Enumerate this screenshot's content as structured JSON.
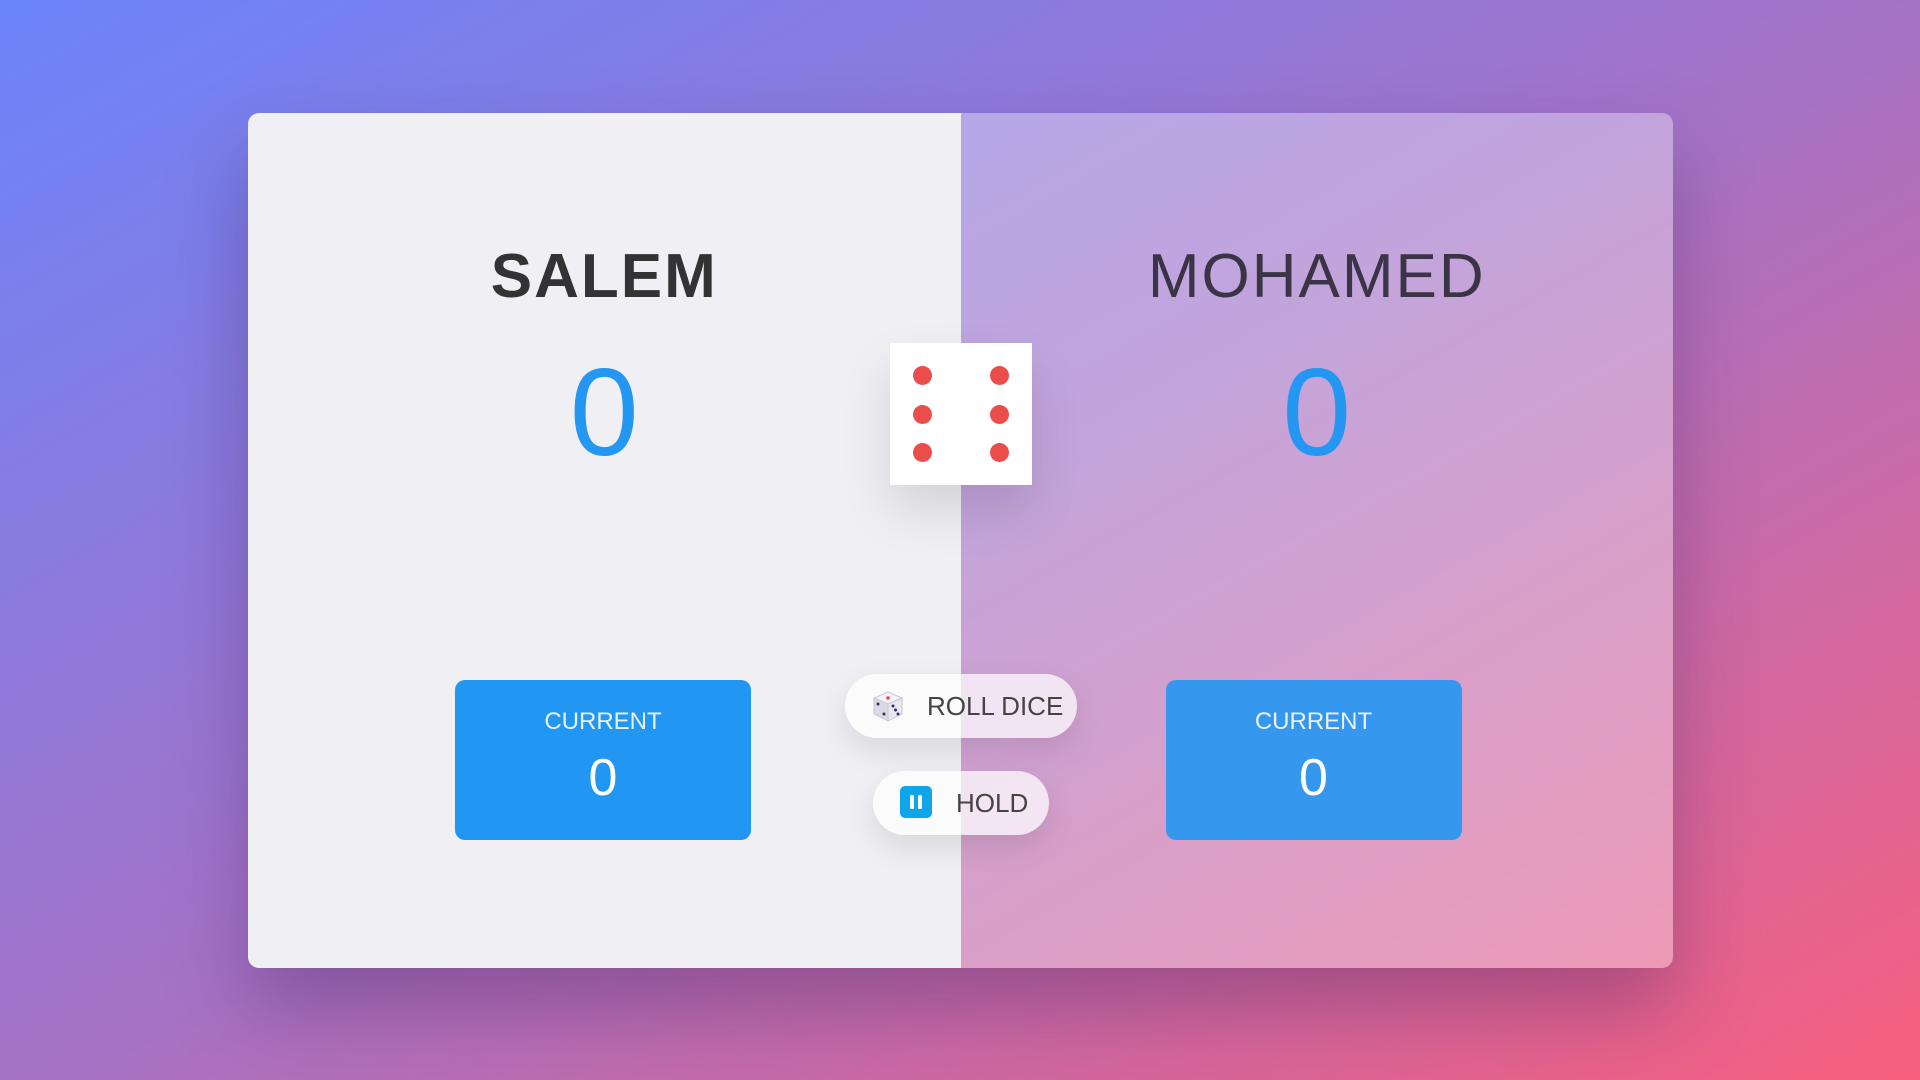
{
  "players": [
    {
      "name": "Salem",
      "score": "0",
      "current_label": "Current",
      "current_score": "0",
      "active": true
    },
    {
      "name": "Mohamed",
      "score": "0",
      "current_label": "Current",
      "current_score": "0",
      "active": false
    }
  ],
  "dice": {
    "value": 6,
    "pip_color": "#eb4d4b"
  },
  "buttons": {
    "roll_label": "Roll dice",
    "roll_icon": "dice-icon",
    "hold_label": "Hold",
    "hold_icon": "pause-icon"
  },
  "colors": {
    "score": "#2497f3",
    "current_box": "#2196f3",
    "active_panel": "#f0eff4"
  }
}
